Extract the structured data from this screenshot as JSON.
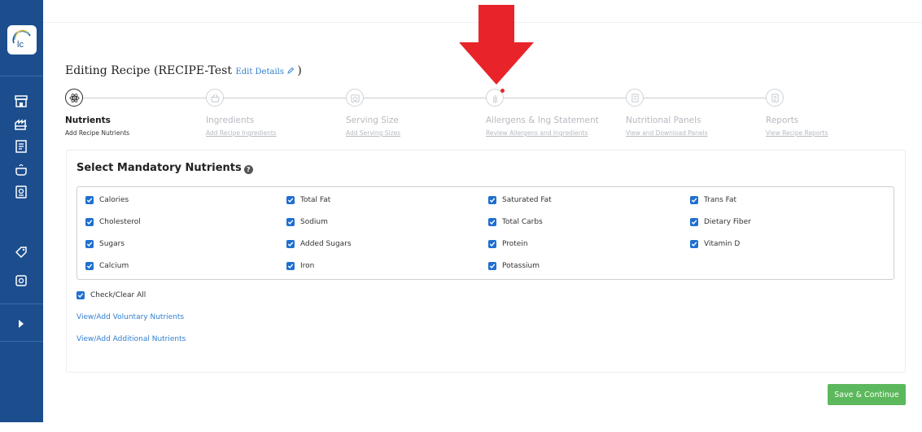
{
  "header": {
    "title_prefix": "Editing Recipe (RECIPE-Test",
    "edit_link": "Edit Details",
    "title_suffix": ")"
  },
  "sidebar": {
    "logo_text": "lc",
    "items": [
      {
        "icon": "store-icon"
      },
      {
        "icon": "factory-icon"
      },
      {
        "icon": "document-icon"
      },
      {
        "icon": "pot-icon"
      },
      {
        "icon": "label-icon"
      },
      {
        "icon": "tag-icon"
      },
      {
        "icon": "settings-icon"
      },
      {
        "icon": "expand-arrow-icon"
      }
    ]
  },
  "steps": [
    {
      "title": "Nutrients",
      "subtitle": "Add Recipe Nutrients",
      "icon": "atom-icon",
      "active": true
    },
    {
      "title": "Ingredients",
      "subtitle": "Add Recipe Ingredients",
      "icon": "basket-icon",
      "active": false
    },
    {
      "title": "Serving Size",
      "subtitle": "Add Serving Sizes",
      "icon": "scale-icon",
      "active": false
    },
    {
      "title": "Allergens & Ing Statement",
      "subtitle": "Review Allergens and Ingredients",
      "icon": "hand-icon",
      "active": false,
      "alert": true
    },
    {
      "title": "Nutritional Panels",
      "subtitle": "View and Download Panels",
      "icon": "panel-icon",
      "active": false
    },
    {
      "title": "Reports",
      "subtitle": "View Recipe Reports",
      "icon": "report-icon",
      "active": false
    }
  ],
  "section": {
    "heading": "Select Mandatory Nutrients",
    "help_icon": "?"
  },
  "nutrients": [
    {
      "label": "Calories",
      "checked": true
    },
    {
      "label": "Total Fat",
      "checked": true
    },
    {
      "label": "Saturated Fat",
      "checked": true
    },
    {
      "label": "Trans Fat",
      "checked": true
    },
    {
      "label": "Cholesterol",
      "checked": true
    },
    {
      "label": "Sodium",
      "checked": true
    },
    {
      "label": "Total Carbs",
      "checked": true
    },
    {
      "label": "Dietary Fiber",
      "checked": true
    },
    {
      "label": "Sugars",
      "checked": true
    },
    {
      "label": "Added Sugars",
      "checked": true
    },
    {
      "label": "Protein",
      "checked": true
    },
    {
      "label": "Vitamin D",
      "checked": true
    },
    {
      "label": "Calcium",
      "checked": true
    },
    {
      "label": "Iron",
      "checked": true
    },
    {
      "label": "Potassium",
      "checked": true
    }
  ],
  "check_all": {
    "label": "Check/Clear All",
    "checked": true
  },
  "links": {
    "voluntary": "View/Add Voluntary Nutrients",
    "additional": "View/Add Additional Nutrients"
  },
  "actions": {
    "save_label": "Save & Continue"
  },
  "colors": {
    "sidebar": "#1c4e8e",
    "accent": "#2f7fd0",
    "checkbox": "#1f6fd0",
    "save_button": "#5cb85c",
    "arrow": "#e8242a"
  }
}
